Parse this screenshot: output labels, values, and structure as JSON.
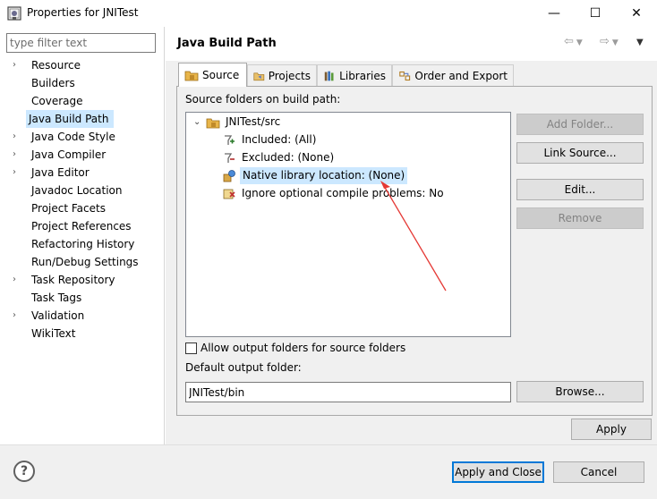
{
  "window": {
    "title": "Properties for JNITest",
    "minimize": "—",
    "maximize": "☐",
    "close": "✕"
  },
  "filter": {
    "placeholder": "type filter text",
    "value": ""
  },
  "nav": {
    "items": [
      {
        "label": "Resource",
        "expandable": true
      },
      {
        "label": "Builders",
        "expandable": false
      },
      {
        "label": "Coverage",
        "expandable": false
      },
      {
        "label": "Java Build Path",
        "expandable": false,
        "selected": true
      },
      {
        "label": "Java Code Style",
        "expandable": true
      },
      {
        "label": "Java Compiler",
        "expandable": true
      },
      {
        "label": "Java Editor",
        "expandable": true
      },
      {
        "label": "Javadoc Location",
        "expandable": false
      },
      {
        "label": "Project Facets",
        "expandable": false
      },
      {
        "label": "Project References",
        "expandable": false
      },
      {
        "label": "Refactoring History",
        "expandable": false
      },
      {
        "label": "Run/Debug Settings",
        "expandable": false
      },
      {
        "label": "Task Repository",
        "expandable": true
      },
      {
        "label": "Task Tags",
        "expandable": false
      },
      {
        "label": "Validation",
        "expandable": true
      },
      {
        "label": "WikiText",
        "expandable": false
      }
    ]
  },
  "page": {
    "title": "Java Build Path",
    "tabs": [
      "Source",
      "Projects",
      "Libraries",
      "Order and Export"
    ],
    "active_tab": "Source",
    "source_folders_label": "Source folders on build path:",
    "tree": {
      "root": "JNITest/src",
      "children": [
        "Included: (All)",
        "Excluded: (None)",
        "Native library location: (None)",
        "Ignore optional compile problems: No"
      ],
      "selected_index": 2
    },
    "buttons": {
      "add_folder": "Add Folder...",
      "link_source": "Link Source...",
      "edit": "Edit...",
      "remove": "Remove",
      "browse": "Browse..."
    },
    "allow_output_label": "Allow output folders for source folders",
    "allow_output_checked": false,
    "default_output_label": "Default output folder:",
    "default_output_value": "JNITest/bin",
    "apply": "Apply"
  },
  "footer": {
    "help": "?",
    "apply_and_close": "Apply and Close",
    "cancel": "Cancel"
  },
  "colors": {
    "selection": "#cce8ff",
    "annotation_arrow": "#e53935",
    "default_button_border": "#0078d7"
  }
}
